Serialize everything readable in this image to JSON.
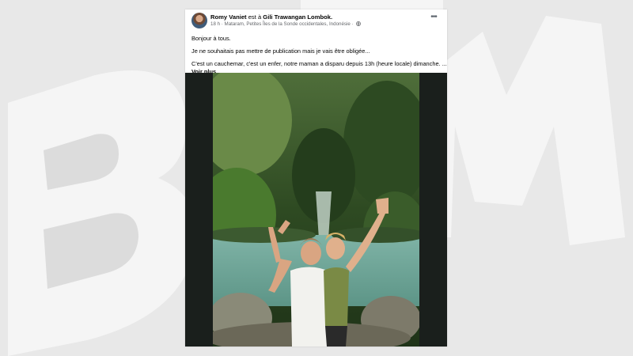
{
  "background": {
    "watermark_text": "BFM",
    "color": "#f4f4f4"
  },
  "post": {
    "author": "Romy Vaniet",
    "relation": "est à",
    "location": "Gili Trawangan Lombok",
    "time": "18 h",
    "place": "Mataram, Petites Îles de la Sonde occidentales, Indonésie",
    "visibility_icon": "globe-icon",
    "more_icon": "more-options-icon",
    "paragraphs": [
      "Bonjour à tous.",
      "Je ne souhaitais pas mettre de publication mais je vais être obligée...",
      "C'est un cauchemar, c'est un enfer, notre maman a disparu depuis 13h (heure locale) dimanche. ..."
    ],
    "see_more": "Voir plus",
    "photo_description_icon": "photo"
  }
}
